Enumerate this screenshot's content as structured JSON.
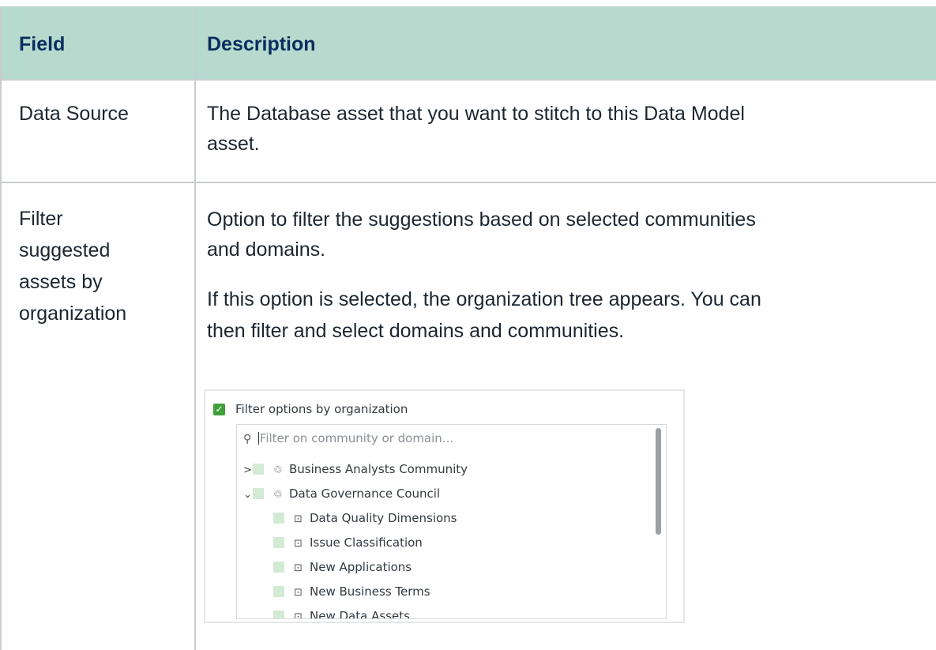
{
  "table": {
    "headers": {
      "field": "Field",
      "description": "Description"
    },
    "rows": [
      {
        "field_lines": [
          "Data Source"
        ],
        "description_lines": [
          "The Database asset that you want to stitch to this Data Model",
          "asset."
        ]
      },
      {
        "field_lines": [
          "Filter",
          "suggested",
          "assets by",
          "organization"
        ],
        "paragraph1_lines": [
          "Option to filter the suggestions based on selected communities",
          "and domains."
        ],
        "paragraph2_lines": [
          "If this option is selected, the organization tree appears. You can",
          "then filter and select domains and communities."
        ]
      }
    ]
  },
  "screenshot": {
    "checkbox_label": "Filter options by organization",
    "checkbox_checked": true,
    "search_placeholder": "Filter on community or domain...",
    "items": [
      {
        "label": "Business Analysts Community",
        "icon": "community-icon",
        "chevron": ">"
      },
      {
        "label": "Data Governance Council",
        "icon": "community-icon",
        "chevron": "⌄"
      },
      {
        "label": "Data Quality Dimensions",
        "icon": "domain-icon"
      },
      {
        "label": "Issue Classification",
        "icon": "domain-icon"
      },
      {
        "label": "New Applications",
        "icon": "domain-icon"
      },
      {
        "label": "New Business Terms",
        "icon": "domain-icon"
      },
      {
        "label": "New Data Assets",
        "icon": "domain-icon"
      }
    ],
    "colors": {
      "checkbox": "#3f9f3a",
      "item_square": "#d3ead4",
      "header_bg": "#b6dace"
    }
  }
}
